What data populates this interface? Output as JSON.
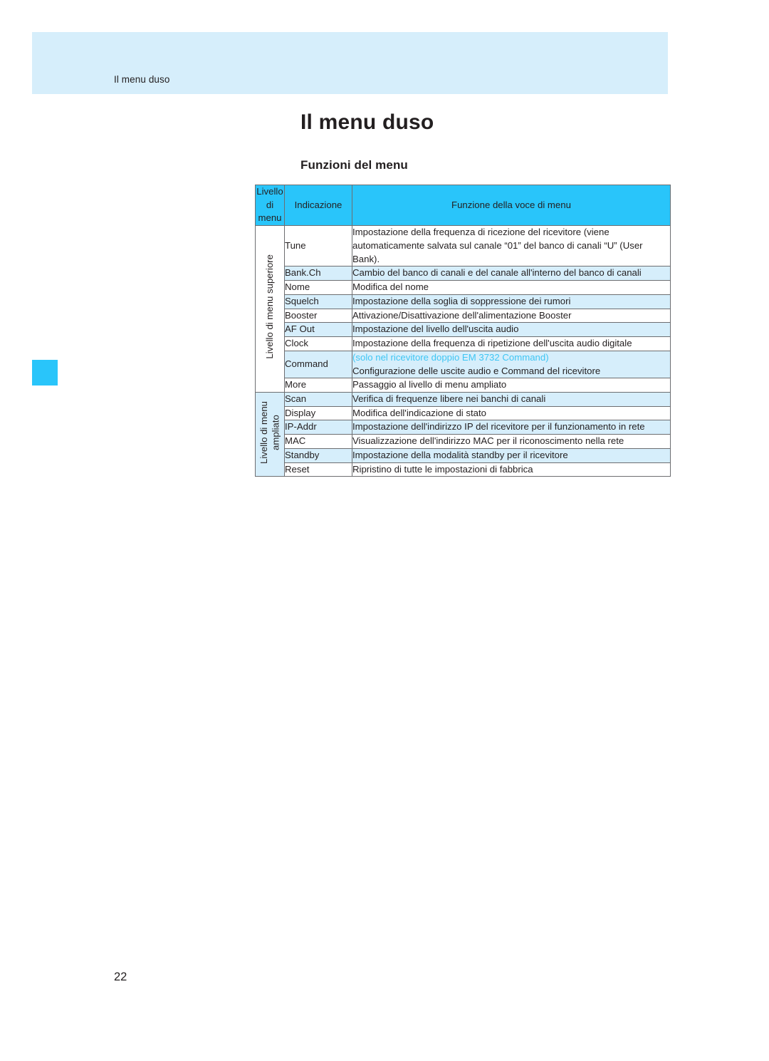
{
  "page": {
    "running_header": "Il menu duso",
    "chapter_title": "Il menu duso",
    "section_title": "Funzioni del menu",
    "folio": "22",
    "accent_color": "#29c5fa",
    "band_color": "#d6eefb",
    "link_text_color": "#3fc6f4",
    "text_color": "#231f20"
  },
  "table": {
    "headers": {
      "level": "Livello\ndi\nmenu",
      "indication": "Indicazione",
      "function": "Funzione della voce di menu"
    },
    "groups": [
      {
        "label": "Livello di menu superiore",
        "rows": [
          {
            "indication": "Tune",
            "function": "Impostazione della frequenza di ricezione del ricevitore (viene automaticamente salvata sul canale “01” del banco di canali “U” (User Bank)."
          },
          {
            "indication": "Bank.Ch",
            "function": "Cambio del banco di canali e del canale all'interno del banco di canali"
          },
          {
            "indication": "Nome",
            "function": "Modifica del nome"
          },
          {
            "indication": "Squelch",
            "function": "Impostazione della soglia di soppressione dei rumori"
          },
          {
            "indication": "Booster",
            "function": "Attivazione/Disattivazione dell'alimentazione Booster"
          },
          {
            "indication": "AF Out",
            "function": "Impostazione del livello dell'uscita audio"
          },
          {
            "indication": "Clock",
            "function": "Impostazione della frequenza di ripetizione dell'uscita audio digitale"
          },
          {
            "indication": "Command",
            "note": "(solo nel ricevitore doppio EM 3732 Command)",
            "function": "Configurazione delle uscite audio e Command del ricevitore"
          },
          {
            "indication": "More",
            "function": "Passaggio al livello di menu ampliato"
          }
        ]
      },
      {
        "label": "Livello di menu\nampliato",
        "rows": [
          {
            "indication": "Scan",
            "function": "Verifica di frequenze libere nei banchi di canali"
          },
          {
            "indication": "Display",
            "function": "Modifica dell'indicazione di stato"
          },
          {
            "indication": "IP-Addr",
            "function": "Impostazione dell'indirizzo IP del ricevitore per il funzionamento in rete"
          },
          {
            "indication": "MAC",
            "function": "Visualizzazione dell'indirizzo MAC per il riconoscimento nella rete"
          },
          {
            "indication": "Standby",
            "function": "Impostazione della modalità standby per il ricevitore"
          },
          {
            "indication": "Reset",
            "function": "Ripristino di tutte le impostazioni di fabbrica"
          }
        ]
      }
    ]
  }
}
